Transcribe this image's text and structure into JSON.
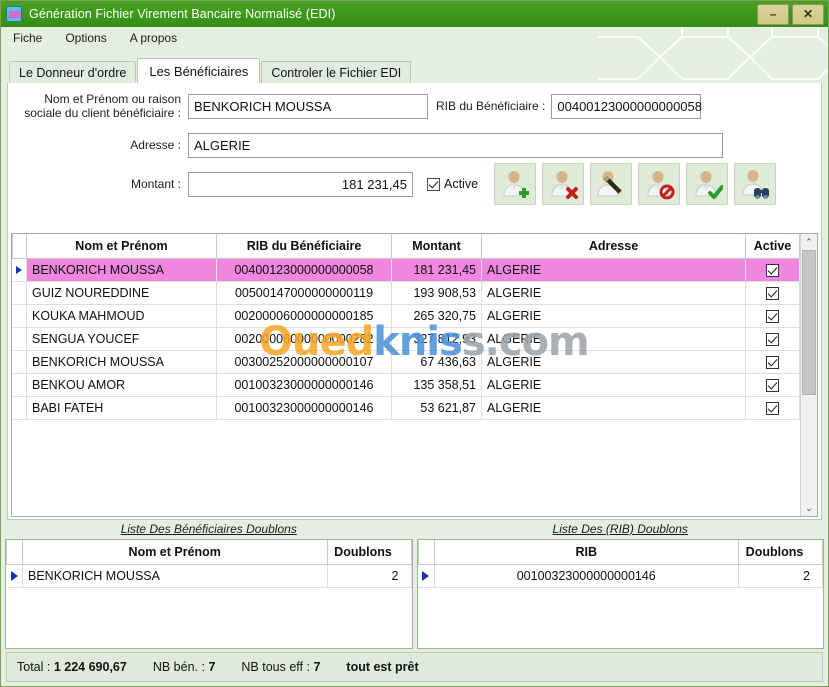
{
  "window": {
    "title": "Génération Fichier Virement Bancaire Normalisé (EDI)",
    "app_icon": "app-icon",
    "minimize_label": "–",
    "close_label": "✕",
    "titlebar_color": "#3e9a1b"
  },
  "menu": {
    "items": [
      {
        "label": "Fiche"
      },
      {
        "label": "Options"
      },
      {
        "label": "A propos"
      }
    ]
  },
  "tabs": [
    {
      "label": "Le Donneur d'ordre",
      "active": false
    },
    {
      "label": "Les Bénéficiaires",
      "active": true
    },
    {
      "label": "Controler le Fichier EDI",
      "active": false
    }
  ],
  "form": {
    "name_label_line1": "Nom et Prénom ou raison",
    "name_label_line2": "sociale du client bénéficiaire :",
    "name_value": "BENKORICH   MOUSSA",
    "rib_label": "RIB du Bénéficiaire :",
    "rib_value": "00400123000000000058",
    "address_label": "Adresse :",
    "address_value": "ALGERIE",
    "amount_label": "Montant :",
    "amount_value": "181 231,45",
    "active_label": "Active",
    "active_checked": true,
    "buttons": [
      {
        "name": "add-beneficiary-button",
        "icon": "user-add-icon"
      },
      {
        "name": "delete-beneficiary-button",
        "icon": "user-delete-icon"
      },
      {
        "name": "edit-beneficiary-button",
        "icon": "user-edit-icon"
      },
      {
        "name": "disable-beneficiary-button",
        "icon": "user-block-icon"
      },
      {
        "name": "validate-beneficiary-button",
        "icon": "user-check-icon"
      },
      {
        "name": "search-beneficiary-button",
        "icon": "user-search-icon"
      }
    ]
  },
  "grid": {
    "columns": [
      "Nom et Prénom",
      "RIB du Bénéficiaire",
      "Montant",
      "Adresse",
      "Active"
    ],
    "rows": [
      {
        "nom": "BENKORICH   MOUSSA",
        "rib": "00400123000000000058",
        "montant": "181 231,45",
        "adresse": "ALGERIE",
        "active": true,
        "selected": true
      },
      {
        "nom": "GUIZ     NOUREDDINE",
        "rib": "00500147000000000119",
        "montant": "193 908,53",
        "adresse": "ALGERIE",
        "active": true,
        "selected": false
      },
      {
        "nom": "KOUKA    MAHMOUD",
        "rib": "00200006000000000185",
        "montant": "265 320,75",
        "adresse": "ALGERIE",
        "active": true,
        "selected": false
      },
      {
        "nom": "SENGUA    YOUCEF",
        "rib": "00200006000000000282",
        "montant": "327 812,93",
        "adresse": "ALGERIE",
        "active": true,
        "selected": false
      },
      {
        "nom": "BENKORICH   MOUSSA",
        "rib": "00300252000000000107",
        "montant": "67 436,63",
        "adresse": "ALGERIE",
        "active": true,
        "selected": false
      },
      {
        "nom": "BENKOU    AMOR",
        "rib": "00100323000000000146",
        "montant": "135 358,51",
        "adresse": "ALGERIE",
        "active": true,
        "selected": false
      },
      {
        "nom": "BABI FATEH",
        "rib": "00100323000000000146",
        "montant": "53 621,87",
        "adresse": "ALGERIE",
        "active": true,
        "selected": false
      }
    ],
    "selected_row_color": "#ef86e0",
    "scroll_up_glyph": "⌃",
    "scroll_down_glyph": "⌄"
  },
  "duplicates_name": {
    "title": "Liste Des Bénéficiaires Doublons",
    "columns": [
      "Nom et Prénom",
      "Doublons"
    ],
    "rows": [
      {
        "value": "BENKORICH   MOUSSA",
        "count": "2"
      }
    ]
  },
  "duplicates_rib": {
    "title": "Liste Des (RIB) Doublons",
    "columns": [
      "RIB",
      "Doublons"
    ],
    "rows": [
      {
        "value": "00100323000000000146",
        "count": "2"
      }
    ]
  },
  "status": {
    "total_label": "Total :",
    "total_value": "1 224 690,67",
    "nb_ben_label": "NB bén. :",
    "nb_ben_value": "7",
    "nb_tous_label": "NB tous eff :",
    "nb_tous_value": "7",
    "ready_text": "tout est prêt"
  },
  "watermark": {
    "part1": "Oued",
    "part2": "knis",
    "part3": "s.com"
  }
}
